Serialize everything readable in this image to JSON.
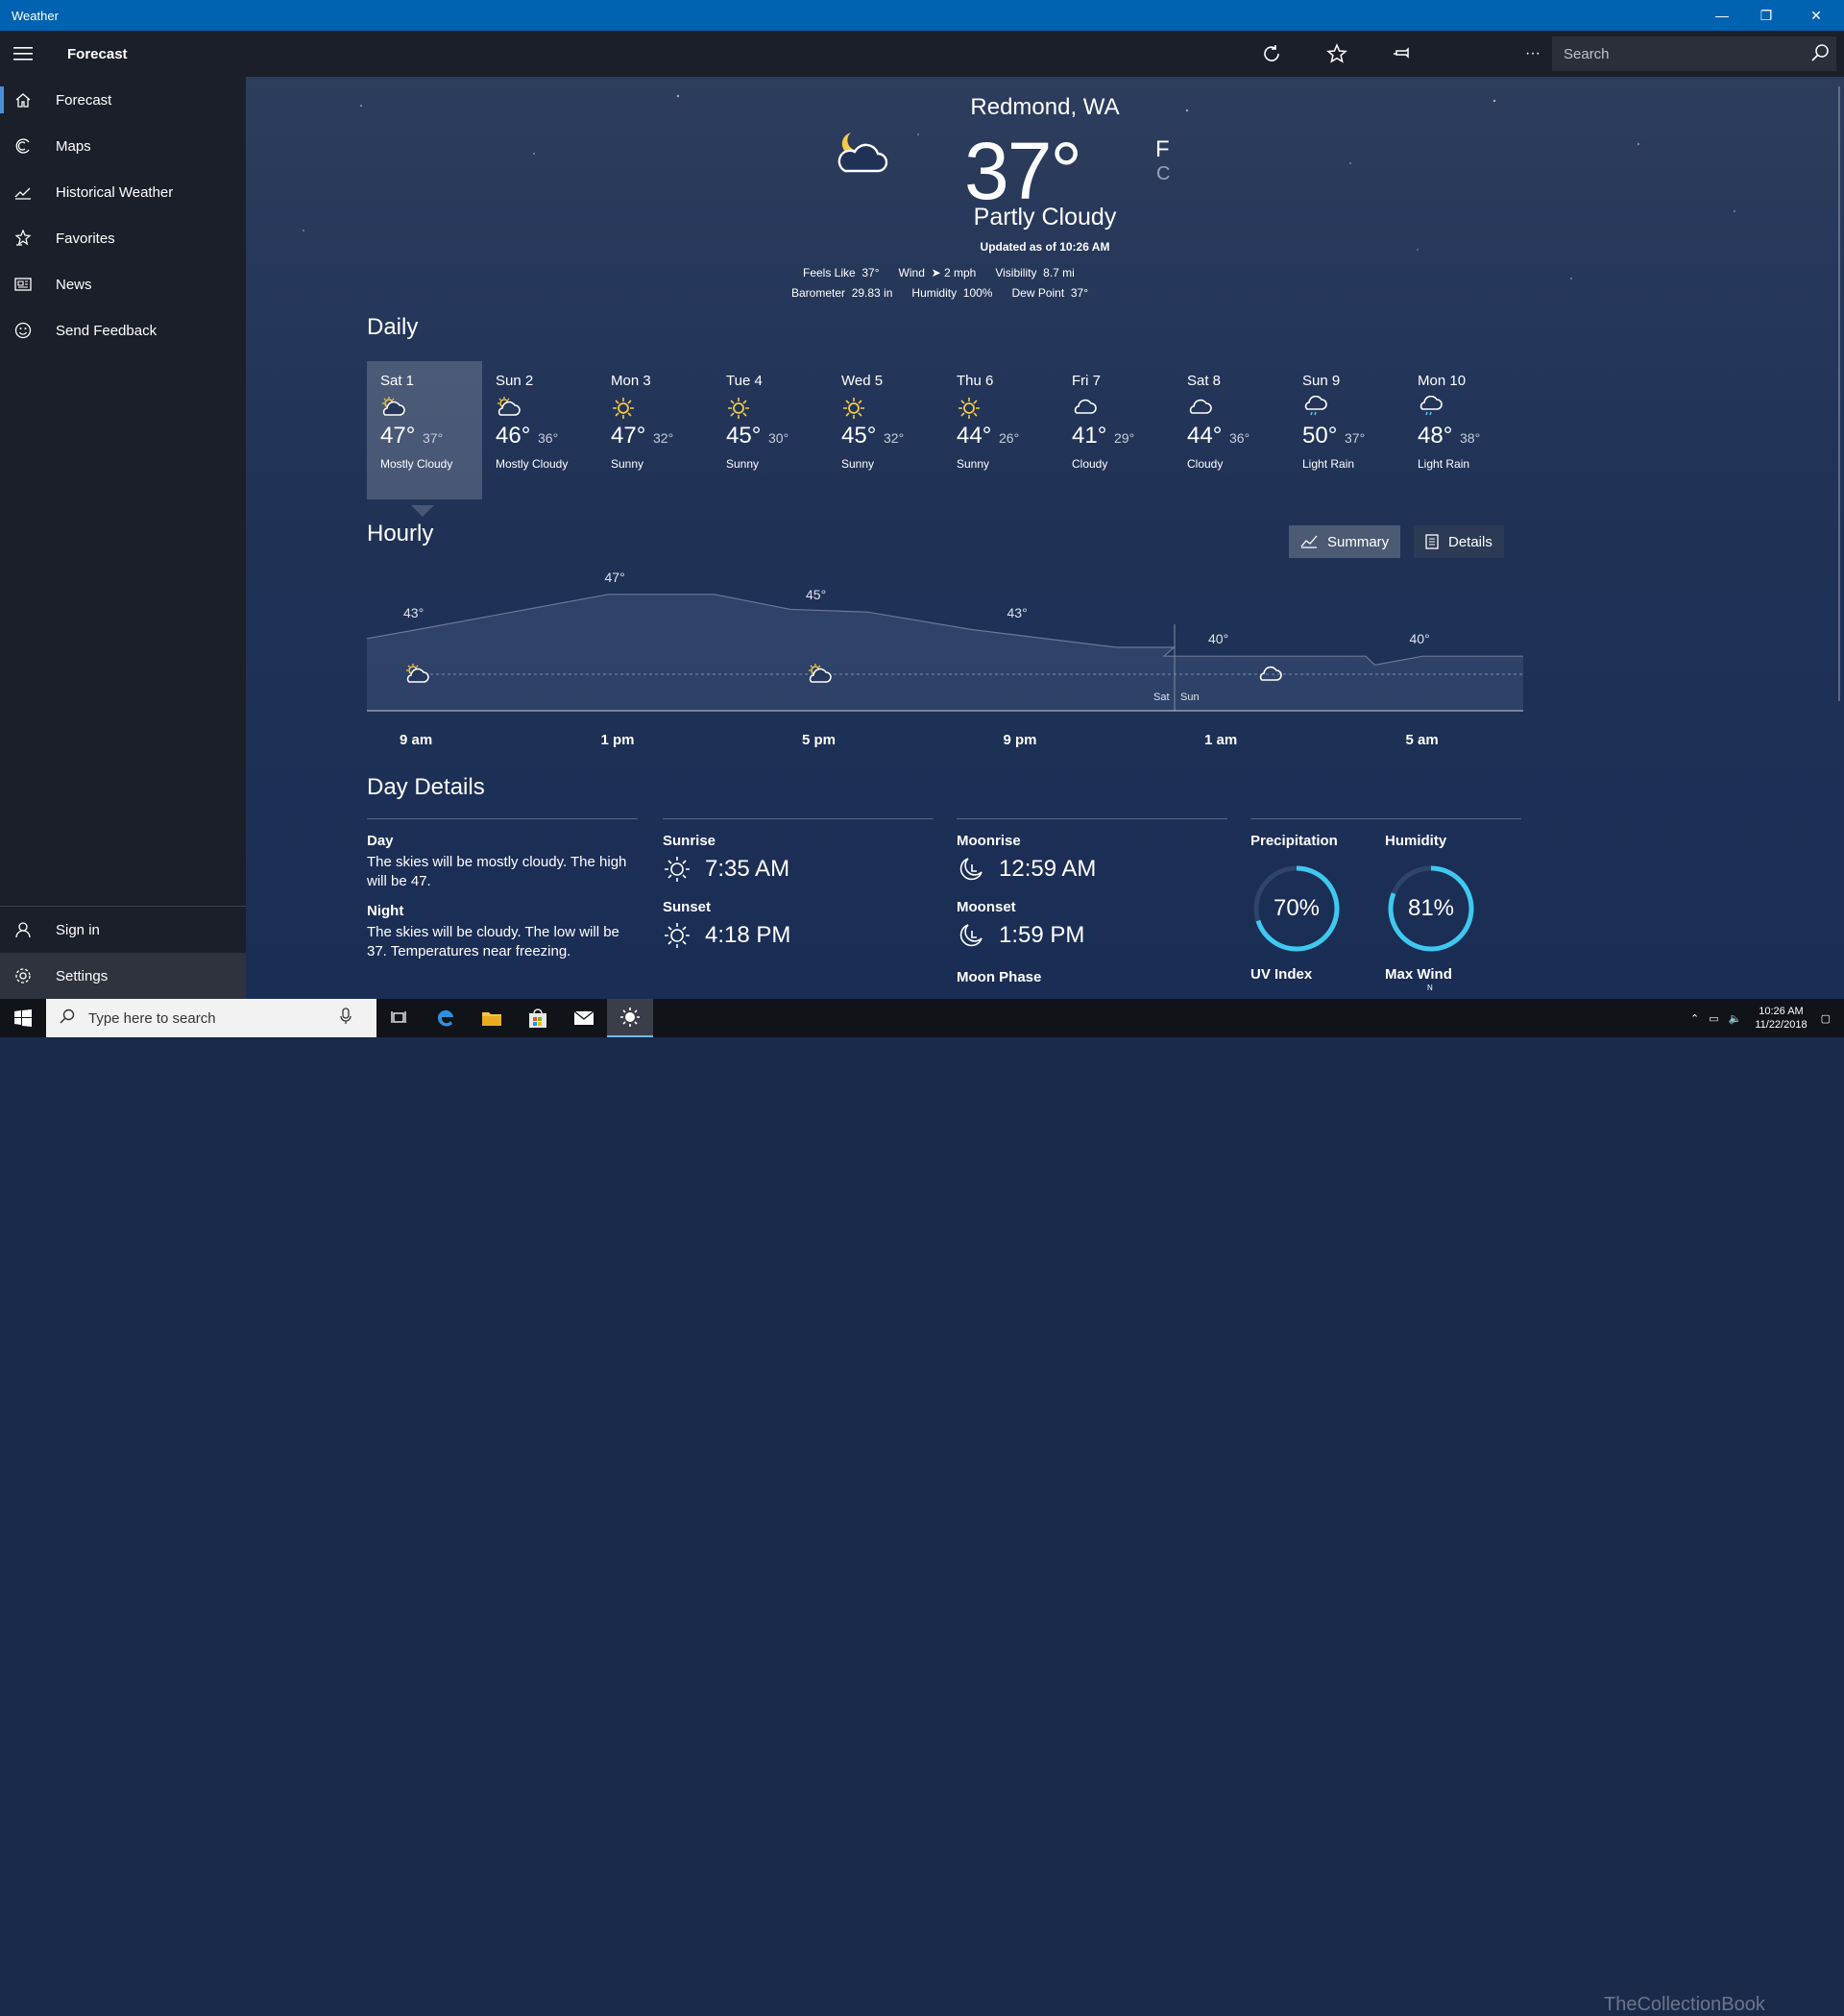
{
  "window": {
    "title": "Weather",
    "minimize": "—",
    "restore": "❐",
    "close": "✕"
  },
  "commandbar": {
    "title": "Forecast",
    "search_placeholder": "Search",
    "more": "···"
  },
  "sidebar": {
    "items": [
      {
        "label": "Forecast",
        "icon": "home-icon"
      },
      {
        "label": "Maps",
        "icon": "maps-icon"
      },
      {
        "label": "Historical Weather",
        "icon": "chart-icon"
      },
      {
        "label": "Favorites",
        "icon": "star-icon"
      },
      {
        "label": "News",
        "icon": "news-icon"
      },
      {
        "label": "Send Feedback",
        "icon": "smiley-icon"
      }
    ],
    "bottom": [
      {
        "label": "Sign in",
        "icon": "person-icon"
      },
      {
        "label": "Settings",
        "icon": "gear-icon"
      }
    ]
  },
  "current": {
    "city": "Redmond, WA",
    "temp": "37°",
    "unit_f": "F",
    "unit_c": "C",
    "condition": "Partly Cloudy",
    "updated": "Updated as of 10:26 AM",
    "feels_like_label": "Feels Like",
    "feels_like": "37°",
    "wind_label": "Wind",
    "wind": "2 mph",
    "visibility_label": "Visibility",
    "visibility": "8.7 mi",
    "barometer_label": "Barometer",
    "barometer": "29.83 in",
    "humidity_label": "Humidity",
    "humidity": "100%",
    "dew_point_label": "Dew Point",
    "dew_point": "37°"
  },
  "daily": {
    "title": "Daily",
    "days": [
      {
        "name": "Sat 1",
        "hi": "47°",
        "lo": "37°",
        "cond": "Mostly Cloudy",
        "icon": "mostly-cloudy"
      },
      {
        "name": "Sun 2",
        "hi": "46°",
        "lo": "36°",
        "cond": "Mostly Cloudy",
        "icon": "mostly-cloudy"
      },
      {
        "name": "Mon 3",
        "hi": "47°",
        "lo": "32°",
        "cond": "Sunny",
        "icon": "sunny"
      },
      {
        "name": "Tue 4",
        "hi": "45°",
        "lo": "30°",
        "cond": "Sunny",
        "icon": "sunny"
      },
      {
        "name": "Wed 5",
        "hi": "45°",
        "lo": "32°",
        "cond": "Sunny",
        "icon": "sunny"
      },
      {
        "name": "Thu 6",
        "hi": "44°",
        "lo": "26°",
        "cond": "Sunny",
        "icon": "sunny"
      },
      {
        "name": "Fri 7",
        "hi": "41°",
        "lo": "29°",
        "cond": "Cloudy",
        "icon": "cloudy"
      },
      {
        "name": "Sat 8",
        "hi": "44°",
        "lo": "36°",
        "cond": "Cloudy",
        "icon": "cloudy"
      },
      {
        "name": "Sun 9",
        "hi": "50°",
        "lo": "37°",
        "cond": "Light Rain",
        "icon": "light-rain"
      },
      {
        "name": "Mon 10",
        "hi": "48°",
        "lo": "38°",
        "cond": "Light Rain",
        "icon": "light-rain"
      }
    ]
  },
  "hourly": {
    "title": "Hourly",
    "summary_label": "Summary",
    "details_label": "Details",
    "temp_labels": [
      "43°",
      "47°",
      "45°",
      "43°",
      "40°",
      "40°"
    ],
    "times": [
      "9 am",
      "1 pm",
      "5 pm",
      "9 pm",
      "1 am",
      "5 am"
    ],
    "day_divider": [
      "Sat",
      "Sun"
    ]
  },
  "chart_data": {
    "type": "area",
    "x": [
      "9 am",
      "1 pm",
      "5 pm",
      "9 pm",
      "1 am",
      "5 am"
    ],
    "series": [
      {
        "values": [
          43,
          47,
          45,
          43,
          40,
          40
        ]
      }
    ]
  },
  "day_details": {
    "title": "Day Details",
    "day_label": "Day",
    "day_text": "The skies will be mostly cloudy. The high will be 47.",
    "night_label": "Night",
    "night_text": "The skies will be cloudy. The low will be 37. Temperatures near freezing.",
    "sunrise_label": "Sunrise",
    "sunrise": "7:35 AM",
    "sunset_label": "Sunset",
    "sunset": "4:18 PM",
    "moonrise_label": "Moonrise",
    "moonrise": "12:59 AM",
    "moonset_label": "Moonset",
    "moonset": "1:59 PM",
    "moonphase_label": "Moon Phase",
    "precip_label": "Precipitation",
    "precip": "70%",
    "precip_value": 0.7,
    "humidity_label": "Humidity",
    "humidity": "81%",
    "humidity_value": 0.81,
    "uv_label": "UV Index",
    "maxwind_label": "Max Wind",
    "maxwind_dir": "N"
  },
  "taskbar": {
    "search_placeholder": "Type here to search",
    "time": "10:26 AM",
    "date": "11/22/2018"
  },
  "watermark": "TheCollectionBook",
  "colors": {
    "accent": "#0063b1",
    "gauge": "#3fc8f0",
    "sun": "#f7c948"
  }
}
